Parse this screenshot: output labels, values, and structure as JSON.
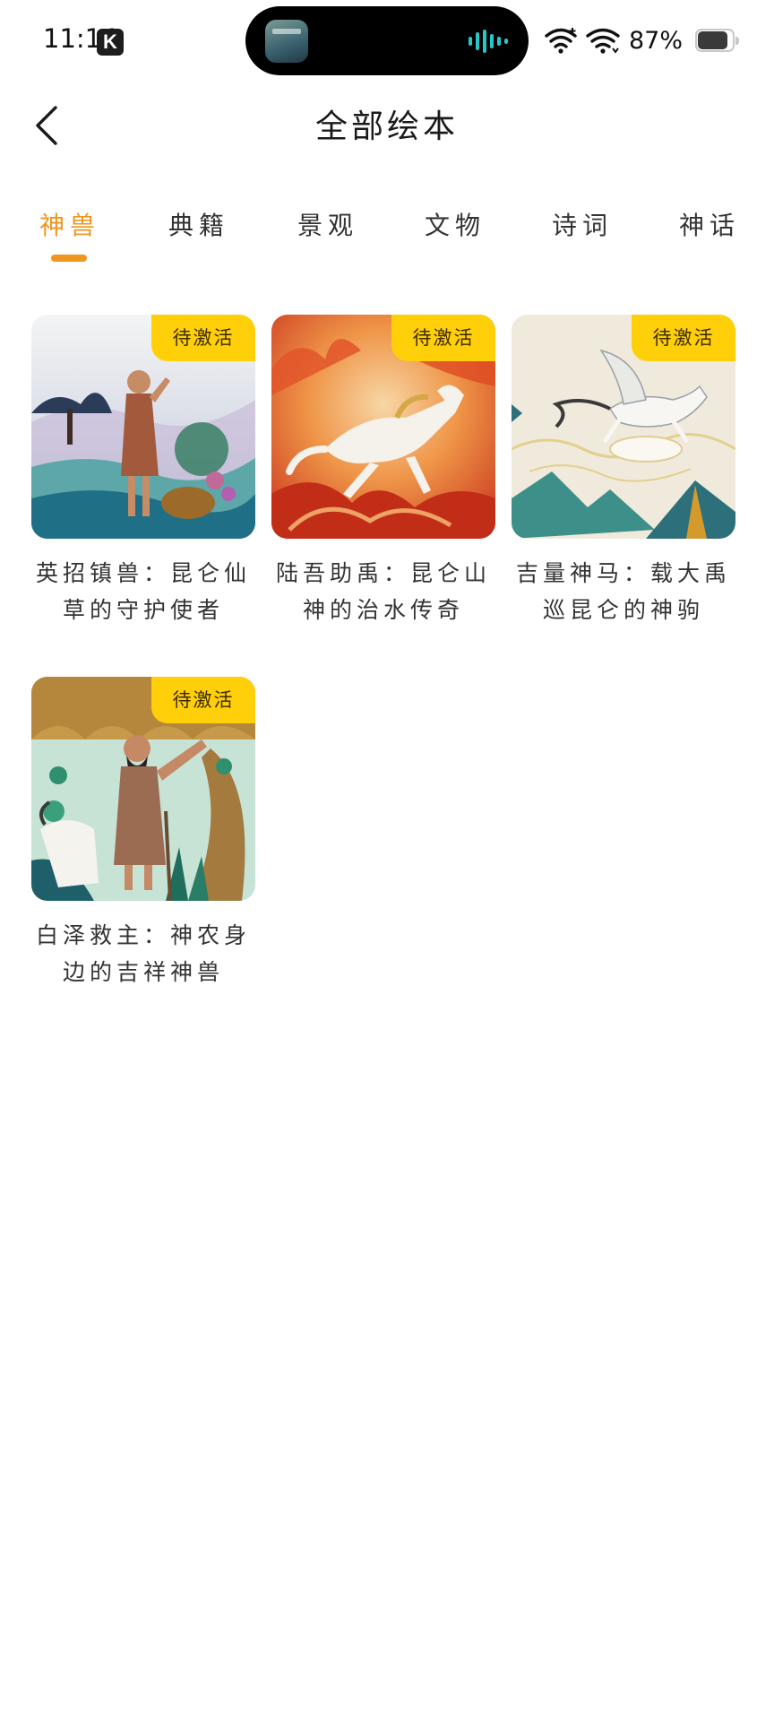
{
  "status_bar": {
    "time": "11:14",
    "app_badge": "K",
    "battery": "87%",
    "battery_level": 0.87
  },
  "header": {
    "title": "全部绘本"
  },
  "tabs": [
    {
      "label": "神兽",
      "active": true
    },
    {
      "label": "典籍",
      "active": false
    },
    {
      "label": "景观",
      "active": false
    },
    {
      "label": "文物",
      "active": false
    },
    {
      "label": "诗词",
      "active": false
    },
    {
      "label": "神话",
      "active": false
    }
  ],
  "books": [
    {
      "title": "英招镇兽：昆仑仙草的守护使者",
      "badge": "待激活"
    },
    {
      "title": "陆吾助禹：昆仑山神的治水传奇",
      "badge": "待激活"
    },
    {
      "title": "吉量神马：载大禹巡昆仑的神驹",
      "badge": "待激活"
    },
    {
      "title": "白泽救主：神农身边的吉祥神兽",
      "badge": "待激活"
    }
  ],
  "colors": {
    "accent": "#f0951e",
    "badge": "#ffcf0a"
  },
  "icons": {
    "back": "chevron-left-icon",
    "wifi": "wifi-icon",
    "battery": "battery-icon",
    "audio": "audio-wave-icon"
  }
}
